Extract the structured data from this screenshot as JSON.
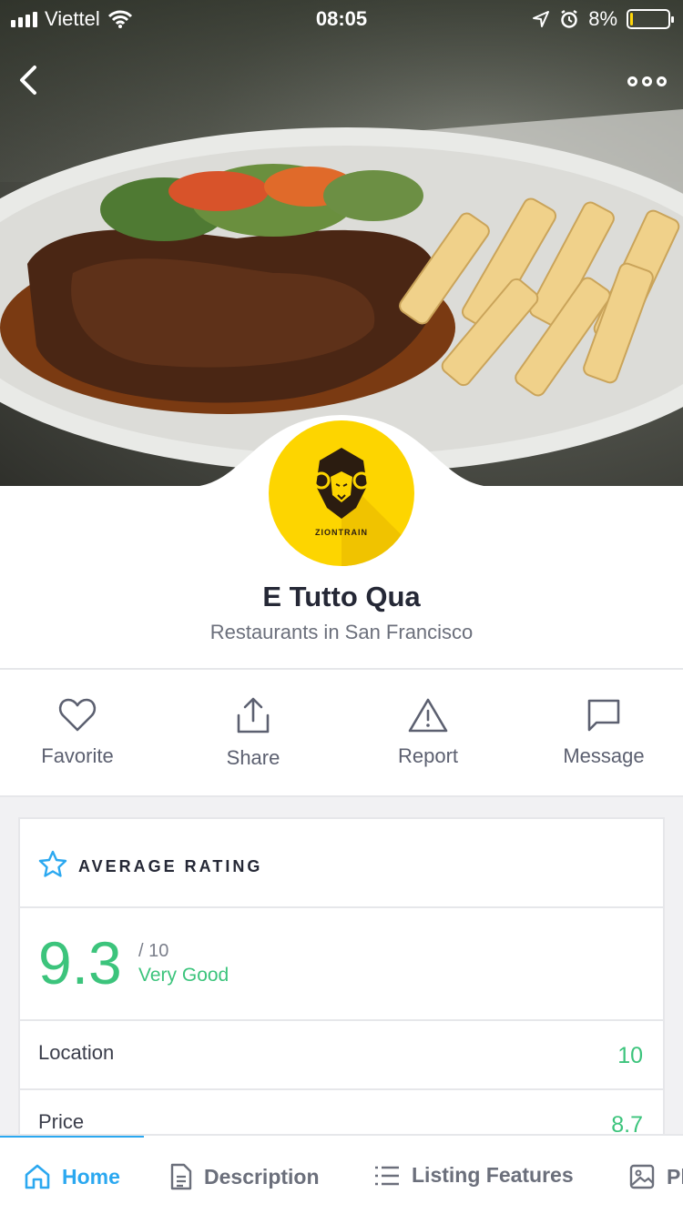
{
  "status_bar": {
    "carrier": "Viettel",
    "time": "08:05",
    "battery": "8%",
    "battery_level": 0.08
  },
  "listing": {
    "name": "E Tutto Qua",
    "subtitle": "Restaurants in San Francisco",
    "logo_text": "ZIONTRAIN"
  },
  "actions": [
    {
      "label": "Favorite",
      "icon": "heart-icon"
    },
    {
      "label": "Share",
      "icon": "share-icon"
    },
    {
      "label": "Report",
      "icon": "warning-icon"
    },
    {
      "label": "Message",
      "icon": "message-icon"
    }
  ],
  "rating": {
    "heading": "AVERAGE RATING",
    "score": "9.3",
    "max": "/ 10",
    "verdict": "Very Good",
    "items": [
      {
        "label": "Location",
        "value": "10"
      },
      {
        "label": "Price",
        "value": "8.7"
      }
    ]
  },
  "tabs": [
    {
      "label": "Home",
      "icon": "home-icon",
      "active": true
    },
    {
      "label": "Description",
      "icon": "document-icon",
      "active": false
    },
    {
      "label": "Listing Features",
      "icon": "list-icon",
      "active": false
    },
    {
      "label": "Ph",
      "icon": "image-icon",
      "active": false
    }
  ],
  "colors": {
    "accent": "#2ba8f0",
    "rating_green": "#3cc47c",
    "logo_yellow": "#fdd500"
  }
}
